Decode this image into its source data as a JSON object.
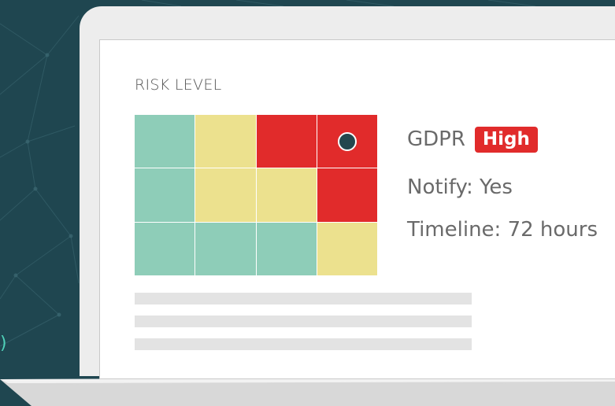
{
  "edge_fragment": ")",
  "panel": {
    "title": "RISK LEVEL",
    "matrix": [
      [
        "green",
        "yellow",
        "red",
        "red"
      ],
      [
        "green",
        "yellow",
        "yellow",
        "red"
      ],
      [
        "green",
        "green",
        "green",
        "yellow"
      ]
    ],
    "marker_cell": {
      "row": 0,
      "col": 3
    },
    "regulation": "GDPR",
    "severity": "High",
    "notify": "Notify: Yes",
    "timeline": "Timeline: 72 hours",
    "placeholder_line_count": 3
  },
  "colors": {
    "background": "#1f4650",
    "green": "#8ecdb8",
    "yellow": "#ece18e",
    "red": "#e12b2b",
    "marker": "#24474e",
    "badge": "#e12b2b",
    "accent_text": "#4fd1b9"
  }
}
